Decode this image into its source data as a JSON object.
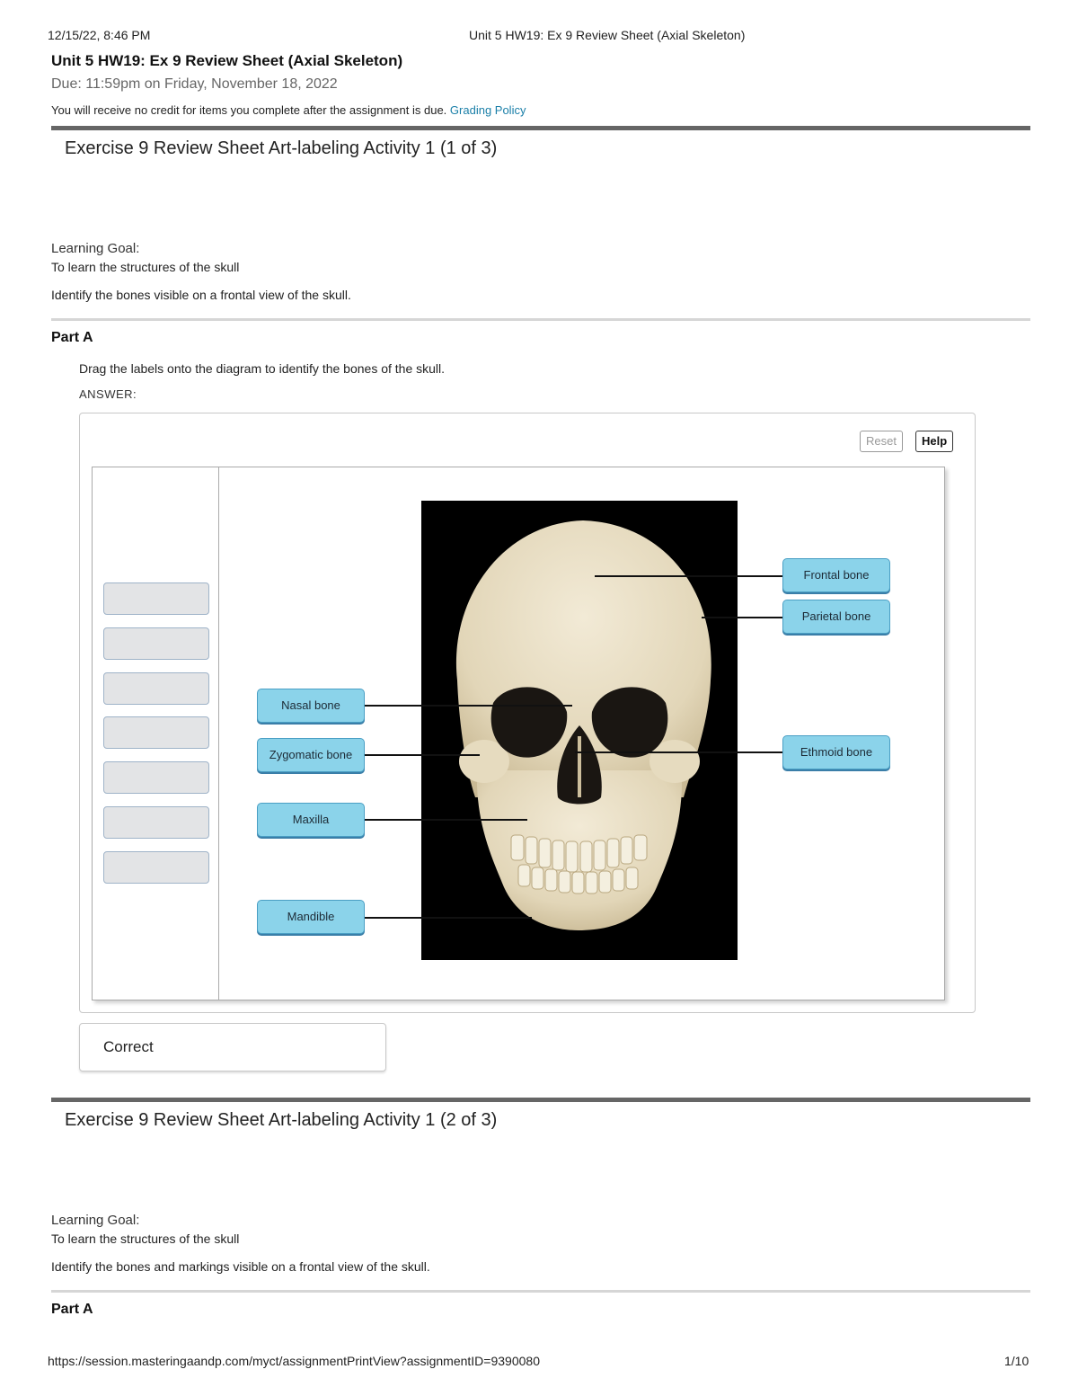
{
  "print_header": {
    "datetime": "12/15/22, 8:46 PM",
    "doc_title": "Unit 5 HW19: Ex 9 Review Sheet (Axial Skeleton)"
  },
  "assignment": {
    "title": "Unit 5 HW19: Ex 9 Review Sheet (Axial Skeleton)",
    "due": "Due: 11:59pm on Friday, November 18, 2022",
    "late_note": "You will receive no credit for items you complete after the assignment is due.",
    "grading_link": "Grading Policy"
  },
  "exercise1": {
    "title": "Exercise 9 Review Sheet Art-labeling Activity 1 (1 of 3)",
    "learning_goal_label": "Learning Goal:",
    "learning_goal_text": "To learn the structures of the skull",
    "instruction": "Identify the bones visible on a frontal view of the skull.",
    "part_label": "Part A",
    "part_instruction": "Drag the labels onto the diagram to identify the bones of the skull.",
    "answer_label": "ANSWER:",
    "reset_label": "Reset",
    "help_label": "Help",
    "labels": {
      "frontal": "Frontal bone",
      "parietal": "Parietal bone",
      "nasal": "Nasal bone",
      "zygomatic": "Zygomatic bone",
      "ethmoid": "Ethmoid bone",
      "maxilla": "Maxilla",
      "mandible": "Mandible"
    },
    "feedback": "Correct"
  },
  "exercise2": {
    "title": "Exercise 9 Review Sheet Art-labeling Activity 1 (2 of 3)",
    "learning_goal_label": "Learning Goal:",
    "learning_goal_text": "To learn the structures of the skull",
    "instruction": "Identify the bones and markings visible on a frontal view of the skull.",
    "part_label": "Part A"
  },
  "print_footer": {
    "url": "https://session.masteringaandp.com/myct/assignmentPrintView?assignmentID=9390080",
    "page": "1/10"
  }
}
